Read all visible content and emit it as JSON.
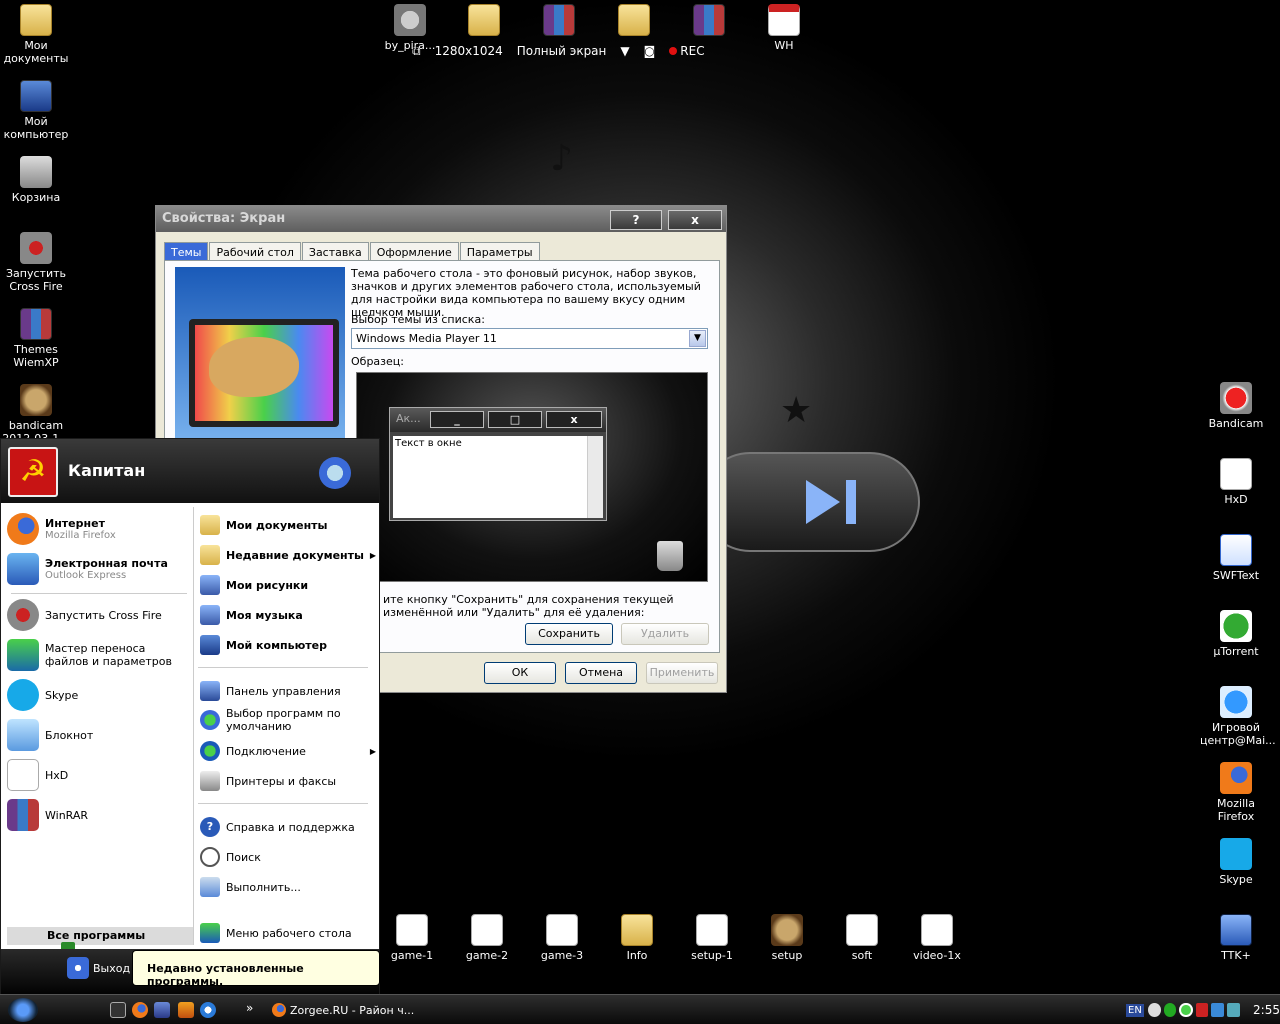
{
  "recorder": {
    "resolution": "1280x1024",
    "mode": "Полный экран",
    "rec": "REC"
  },
  "desktop_left": [
    {
      "label": "Мои документы",
      "icon": "folder-icon"
    },
    {
      "label": "Мой компьютер",
      "icon": "computer-icon"
    },
    {
      "label": "Корзина",
      "icon": "recycle-bin-icon"
    },
    {
      "label": "Запустить Cross Fire",
      "icon": "crossfire-icon"
    },
    {
      "label": "Themes WiemXP",
      "icon": "winrar-icon"
    },
    {
      "label": "bandicam 2012-03-1...",
      "icon": "image-icon"
    }
  ],
  "desktop_top": [
    {
      "label": "by_pira...",
      "icon": "gear-icon"
    },
    {
      "label": "",
      "icon": "folder-icon"
    },
    {
      "label": "",
      "icon": "winrar-icon"
    },
    {
      "label": "",
      "icon": "folder-icon"
    },
    {
      "label": "",
      "icon": "winrar-icon"
    },
    {
      "label": "WH",
      "icon": "document-icon"
    }
  ],
  "desktop_right": [
    {
      "label": "Bandicam",
      "icon": "bandicam-icon"
    },
    {
      "label": "HxD",
      "icon": "hxd-icon"
    },
    {
      "label": "SWFText",
      "icon": "swftext-icon"
    },
    {
      "label": "µTorrent",
      "icon": "utorrent-icon"
    },
    {
      "label": "Игровой центр@Mai...",
      "icon": "game-center-icon"
    },
    {
      "label": "Mozilla Firefox",
      "icon": "firefox-icon"
    },
    {
      "label": "Skype",
      "icon": "skype-icon"
    },
    {
      "label": "TTK+",
      "icon": "ttk-icon"
    }
  ],
  "desktop_bottom": [
    {
      "label": "game-1",
      "icon": "file-icon"
    },
    {
      "label": "game-2",
      "icon": "file-icon"
    },
    {
      "label": "game-3",
      "icon": "file-icon"
    },
    {
      "label": "Info",
      "icon": "folder-icon"
    },
    {
      "label": "setup-1",
      "icon": "file-icon"
    },
    {
      "label": "setup",
      "icon": "lion-icon"
    },
    {
      "label": "soft",
      "icon": "file-icon"
    },
    {
      "label": "video-1x",
      "icon": "file-icon"
    }
  ],
  "dialog": {
    "title": "Свойства: Экран",
    "help": "?",
    "close": "x",
    "tabs": [
      "Темы",
      "Рабочий стол",
      "Заставка",
      "Оформление",
      "Параметры"
    ],
    "description": "Тема рабочего стола - это фоновый рисунок, набор звуков, значков и других элементов рабочего стола, используемый для настройки вида компьютера по вашему вкусу одним щелчком мыши.",
    "theme_label": "Выбор темы из списка:",
    "theme_value": "Windows Media Player 11",
    "sample_label": "Образец:",
    "sample_window_title": "Ак...",
    "sample_window_text": "Текст в окне",
    "save_hint": "ите кнопку \"Сохранить\" для сохранения текущей изменённой или \"Удалить\" для её удаления:",
    "save_button": "Сохранить",
    "delete_button": "Удалить",
    "ok_button": "ОК",
    "cancel_button": "Отмена",
    "apply_button": "Применить"
  },
  "start_menu": {
    "user": "Капитан",
    "pinned": [
      {
        "title": "Интернет",
        "subtitle": "Mozilla Firefox"
      },
      {
        "title": "Электронная почта",
        "subtitle": "Outlook Express"
      }
    ],
    "recent": [
      "Запустить Cross Fire",
      "Мастер переноса файлов и параметров",
      "Skype",
      "Блокнот",
      "HxD",
      "WinRAR"
    ],
    "right_bold": [
      "Мои документы",
      "Недавние документы",
      "Мои рисунки",
      "Моя музыка",
      "Мой компьютер"
    ],
    "right_normal": [
      "Панель управления",
      "Выбор программ по умолчанию",
      "Подключение",
      "Принтеры и факсы"
    ],
    "right_tools": [
      "Справка и поддержка",
      "Поиск",
      "Выполнить..."
    ],
    "desktop_menu": "Меню рабочего стола",
    "all_programs": "Все программы",
    "logout": "Выход"
  },
  "tooltip": "Недавно установленные программы.",
  "taskbar": {
    "task": "Zorgee.RU - Район ч...",
    "lang": "EN",
    "clock": "2:55",
    "chevron": "»"
  }
}
